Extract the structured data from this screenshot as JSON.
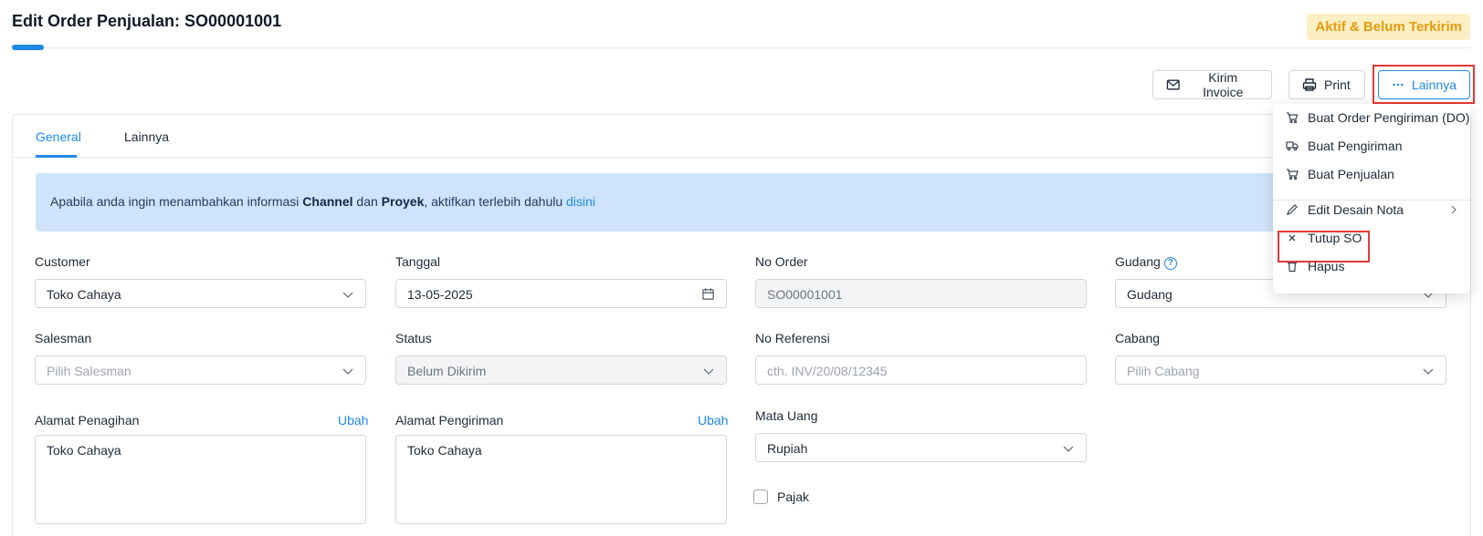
{
  "page": {
    "title": "Edit Order Penjualan: SO00001001",
    "status_badge": "Aktif & Belum Terkirim",
    "progress_fraction": 0.02
  },
  "toolbar": {
    "kirim_invoice": "Kirim Invoice",
    "print": "Print",
    "lainnya": "Lainnya"
  },
  "tabs": [
    {
      "label": "General",
      "active": true
    },
    {
      "label": "Lainnya",
      "active": false
    }
  ],
  "info": {
    "prefix": "Apabila anda ingin menambahkan informasi ",
    "channel": "Channel",
    "and": " dan ",
    "proyek": "Proyek",
    "suffix": ", aktifkan terlebih dahulu ",
    "link": "disini"
  },
  "form": {
    "customer": {
      "label": "Customer",
      "value": "Toko Cahaya"
    },
    "tanggal": {
      "label": "Tanggal",
      "value": "13-05-2025"
    },
    "no_order": {
      "label": "No Order",
      "value": "SO00001001"
    },
    "gudang": {
      "label": "Gudang",
      "value": "Gudang"
    },
    "salesman": {
      "label": "Salesman",
      "placeholder": "Pilih Salesman"
    },
    "status": {
      "label": "Status",
      "value": "Belum Dikirim"
    },
    "no_referensi": {
      "label": "No Referensi",
      "placeholder": "cth. INV/20/08/12345"
    },
    "cabang": {
      "label": "Cabang",
      "placeholder": "Pilih Cabang"
    },
    "alamat_penagihan": {
      "label": "Alamat Penagihan",
      "action": "Ubah",
      "value": "Toko Cahaya"
    },
    "alamat_pengiriman": {
      "label": "Alamat Pengiriman",
      "action": "Ubah",
      "value": "Toko Cahaya"
    },
    "mata_uang": {
      "label": "Mata Uang",
      "value": "Rupiah"
    },
    "pajak": {
      "label": "Pajak",
      "checked": false
    }
  },
  "menu": {
    "items": [
      {
        "label": "Buat Order Pengiriman (DO)",
        "icon": "truck-cart-icon"
      },
      {
        "label": "Buat Pengiriman",
        "icon": "truck-icon"
      },
      {
        "label": "Buat Penjualan",
        "icon": "cart-icon"
      },
      {
        "label": "Edit Desain Nota",
        "icon": "pencil-icon",
        "submenu": true
      },
      {
        "label": "Tutup SO",
        "icon": "close-icon"
      },
      {
        "label": "Hapus",
        "icon": "trash-icon"
      }
    ]
  },
  "colors": {
    "accent": "#1e88e5",
    "badge_bg": "#fdefc3",
    "badge_text": "#e39b0d",
    "info_bg": "#cfe4fb",
    "highlight": "#e53935"
  }
}
